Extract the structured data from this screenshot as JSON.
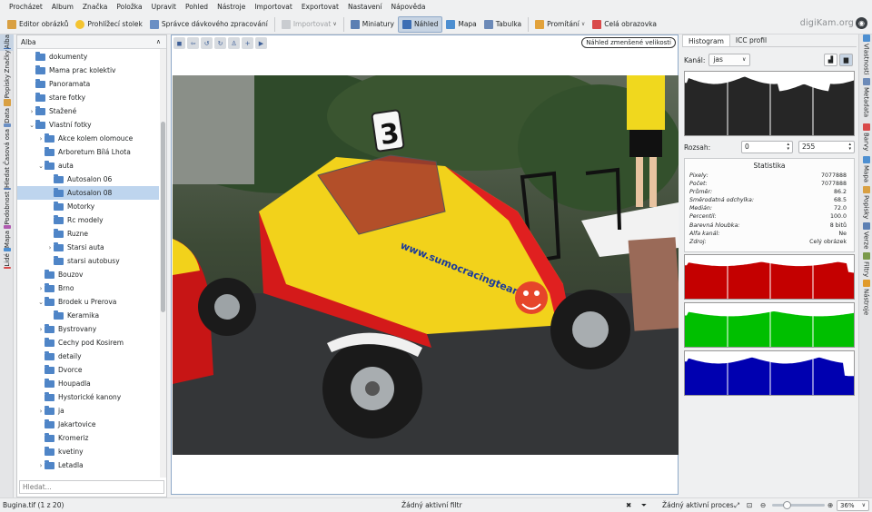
{
  "menu": [
    "Procházet",
    "Album",
    "Značka",
    "Položka",
    "Upravit",
    "Pohled",
    "Nástroje",
    "Importovat",
    "Exportovat",
    "Nastavení",
    "Nápověda"
  ],
  "toolbar": {
    "editor": "Editor obrázků",
    "light_table": "Prohlížecí stolek",
    "batch_queue": "Správce dávkového zpracování",
    "import": "Importovat",
    "thumbnails": "Miniatury",
    "preview": "Náhled",
    "map": "Mapa",
    "table": "Tabulka",
    "slideshow": "Promítání",
    "fullscreen": "Celá obrazovka"
  },
  "brand": "digiKam.org",
  "left_tabs": [
    "Alba",
    "Značky",
    "Popisky",
    "Data",
    "Časová osa",
    "Hledat",
    "Podobnost",
    "Mapa",
    "Lidé"
  ],
  "right_tabs": [
    "Vlastnosti",
    "Metadata",
    "Barvy",
    "Mapa",
    "Popisky",
    "Verze",
    "Filtry",
    "Nástroje"
  ],
  "album_panel": {
    "title": "Alba",
    "search_placeholder": "Hledat...",
    "tree": [
      {
        "label": "dokumenty",
        "depth": 1,
        "expander": ""
      },
      {
        "label": "Mama prac kolektiv",
        "depth": 1,
        "expander": ""
      },
      {
        "label": "Panoramata",
        "depth": 1,
        "expander": ""
      },
      {
        "label": "stare fotky",
        "depth": 1,
        "expander": ""
      },
      {
        "label": "Stažené",
        "depth": 1,
        "expander": "collapsed"
      },
      {
        "label": "Vlastní fotky",
        "depth": 1,
        "expander": "expanded"
      },
      {
        "label": "Akce kolem olomouce",
        "depth": 2,
        "expander": "collapsed"
      },
      {
        "label": "Arboretum Bílá Lhota",
        "depth": 2,
        "expander": ""
      },
      {
        "label": "auta",
        "depth": 2,
        "expander": "expanded"
      },
      {
        "label": "Autosalon 06",
        "depth": 3,
        "expander": ""
      },
      {
        "label": "Autosalon 08",
        "depth": 3,
        "expander": "",
        "selected": true
      },
      {
        "label": "Motorky",
        "depth": 3,
        "expander": ""
      },
      {
        "label": "Rc modely",
        "depth": 3,
        "expander": ""
      },
      {
        "label": "Ruzne",
        "depth": 3,
        "expander": ""
      },
      {
        "label": "Starsi auta",
        "depth": 3,
        "expander": "collapsed"
      },
      {
        "label": "starsi autobusy",
        "depth": 3,
        "expander": ""
      },
      {
        "label": "Bouzov",
        "depth": 2,
        "expander": ""
      },
      {
        "label": "Brno",
        "depth": 2,
        "expander": "collapsed"
      },
      {
        "label": "Brodek u Prerova",
        "depth": 2,
        "expander": "expanded"
      },
      {
        "label": "Keramika",
        "depth": 3,
        "expander": ""
      },
      {
        "label": "Bystrovany",
        "depth": 2,
        "expander": "collapsed"
      },
      {
        "label": "Cechy pod Kosirem",
        "depth": 2,
        "expander": ""
      },
      {
        "label": "detaily",
        "depth": 2,
        "expander": ""
      },
      {
        "label": "Dvorce",
        "depth": 2,
        "expander": ""
      },
      {
        "label": "Houpadla",
        "depth": 2,
        "expander": ""
      },
      {
        "label": "Hystorické kanony",
        "depth": 2,
        "expander": ""
      },
      {
        "label": "ja",
        "depth": 2,
        "expander": "collapsed"
      },
      {
        "label": "Jakartovice",
        "depth": 2,
        "expander": ""
      },
      {
        "label": "Kromeriz",
        "depth": 2,
        "expander": ""
      },
      {
        "label": "kvetiny",
        "depth": 2,
        "expander": ""
      },
      {
        "label": "Letadla",
        "depth": 2,
        "expander": "collapsed"
      }
    ]
  },
  "preview": {
    "label": "Náhled zmenšené velikosti",
    "tools": [
      "◼",
      "⇦",
      "↺",
      "↻",
      "♙",
      "+",
      "▶"
    ],
    "car_number": "3",
    "sticker_text": "www.sumocracingteam.cz"
  },
  "histogram_panel": {
    "tabs": [
      "Histogram",
      "ICC profil"
    ],
    "channel_label": "Kanál:",
    "channel_value": "jas",
    "range_label": "Rozsah:",
    "range_min": "0",
    "range_max": "255",
    "stats_title": "Statistika",
    "stats": [
      {
        "label": "Pixely:",
        "value": "7077888"
      },
      {
        "label": "Počet:",
        "value": "7077888"
      },
      {
        "label": "Průměr:",
        "value": "86.2"
      },
      {
        "label": "Směrodatná odchylka:",
        "value": "68.5"
      },
      {
        "label": "Medián:",
        "value": "72.0"
      },
      {
        "label": "Percentil:",
        "value": "100.0"
      },
      {
        "label": "Barevná hloubka:",
        "value": "8 bitů"
      },
      {
        "label": "Alfa kanál:",
        "value": "Ne"
      },
      {
        "label": "Zdroj:",
        "value": "Celý obrázek"
      }
    ],
    "colors": {
      "luminosity": "#262626",
      "red": "#c40000",
      "green": "#00bf00",
      "blue": "#0000b0"
    }
  },
  "statusbar": {
    "file": "Bugina.tif (1 z 20)",
    "filter": "Žádný aktivní filtr",
    "process": "Žádný aktivní proces",
    "zoom": "36%",
    "zoom_fraction": 0.25
  }
}
